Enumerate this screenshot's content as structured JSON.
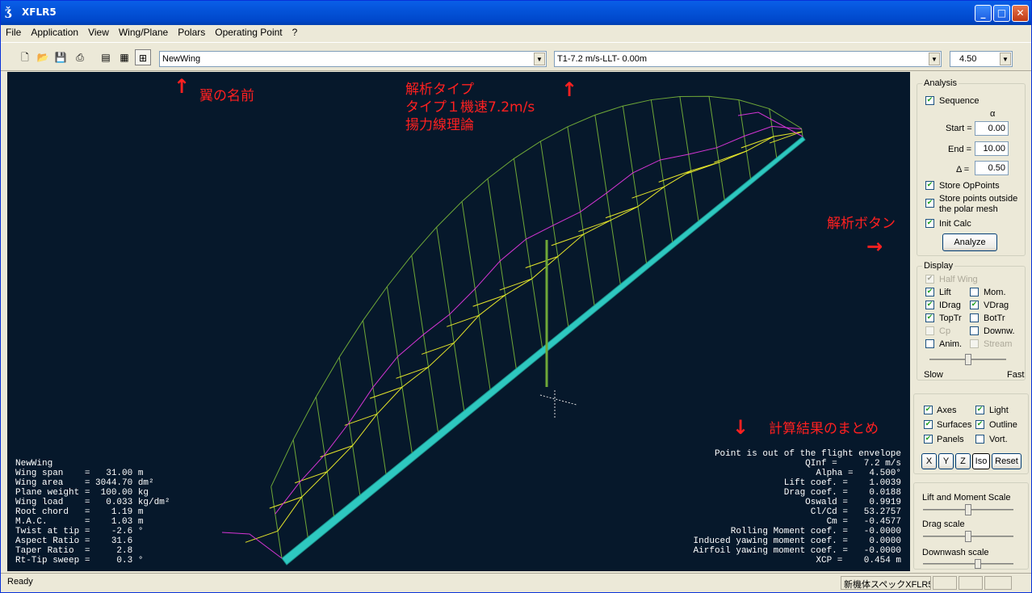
{
  "window": {
    "title": "XFLR5",
    "min": "_",
    "max": "□",
    "close": "✕"
  },
  "menu": [
    "File",
    "Application",
    "View",
    "Wing/Plane",
    "Polars",
    "Operating Point",
    "?"
  ],
  "toolbar": {
    "wing_select": "NewWing",
    "polar_select": "T1-7.2 m/s-LLT-  0.00m",
    "opp_select": "4.50",
    "icons": [
      "new-icon",
      "open-icon",
      "save-icon",
      "print-icon",
      "view-2d-icon",
      "view-polar-icon",
      "view-3d-icon"
    ]
  },
  "annotations": {
    "wing_name": "翼の名前",
    "analysis_type_1": "解析タイプ",
    "analysis_type_2": "タイプ１機速7.2m/s",
    "analysis_type_3": "揚力線理論",
    "analyze_button": "解析ボタン",
    "summary": "計算結果のまとめ",
    "arrow_up": "↑",
    "arrow_right": "→",
    "arrow_down": "↓"
  },
  "wing_info": {
    "name": "NewWing",
    "rows": [
      "Wing span    =   31.00 m",
      "Wing area    = 3044.70 dm²",
      "Plane weight =  100.00 kg",
      "Wing load    =   0.033 kg/dm²",
      "Root chord   =    1.19 m",
      "M.A.C.       =    1.03 m",
      "Twist at tip =    -2.6 °",
      "Aspect Ratio =    31.6",
      "Taper Ratio  =     2.8",
      "Rt-Tip sweep =     0.3 °"
    ]
  },
  "results": {
    "warning": "Point is out of the flight envelope",
    "rows": [
      "QInf =     7.2 m/s",
      "Alpha =   4.500°",
      "Lift coef. =    1.0039",
      "Drag coef. =    0.0188",
      "Oswald =    0.9919",
      "Cl/Cd =   53.2757",
      "Cm =   -0.4577",
      "Rolling Moment coef. =   -0.0000",
      "Induced yawing moment coef. =    0.0000",
      "Airfoil yawing moment coef. =   -0.0000",
      "XCP =    0.454 m"
    ]
  },
  "analysis": {
    "title": "Analysis",
    "sequence": "Sequence",
    "alpha_symbol": "α",
    "start_label": "Start =",
    "start_value": "0.00",
    "end_label": "End =",
    "end_value": "10.00",
    "delta_label": "Δ =",
    "delta_value": "0.50",
    "store_opp": "Store OpPoints",
    "store_outside_1": "Store points outside",
    "store_outside_2": "the polar mesh",
    "init_calc": "Init Calc",
    "analyze": "Analyze"
  },
  "display": {
    "title": "Display",
    "half_wing": "Half Wing",
    "lift": "Lift",
    "mom": "Mom.",
    "idrag": "IDrag",
    "vdrag": "VDrag",
    "toptr": "TopTr",
    "bottr": "BotTr",
    "cp": "Cp",
    "downw": "Downw.",
    "anim": "Anim.",
    "stream": "Stream",
    "slow": "Slow",
    "fast": "Fast"
  },
  "view3d": {
    "axes": "Axes",
    "light": "Light",
    "surfaces": "Surfaces",
    "outline": "Outline",
    "panels": "Panels",
    "vort": "Vort.",
    "x": "X",
    "y": "Y",
    "z": "Z",
    "iso": "Iso",
    "reset": "Reset"
  },
  "scales": {
    "lift_moment": "Lift and Moment Scale",
    "drag": "Drag scale",
    "downwash": "Downwash scale"
  },
  "status": {
    "ready": "Ready",
    "pane": "新機体スペックXFLR5"
  },
  "colors": {
    "background": "#06182b",
    "wing": "#2ec8c0",
    "lift": "#6fa838",
    "idrag": "#e5e52a",
    "vdrag": "#d535d5"
  }
}
